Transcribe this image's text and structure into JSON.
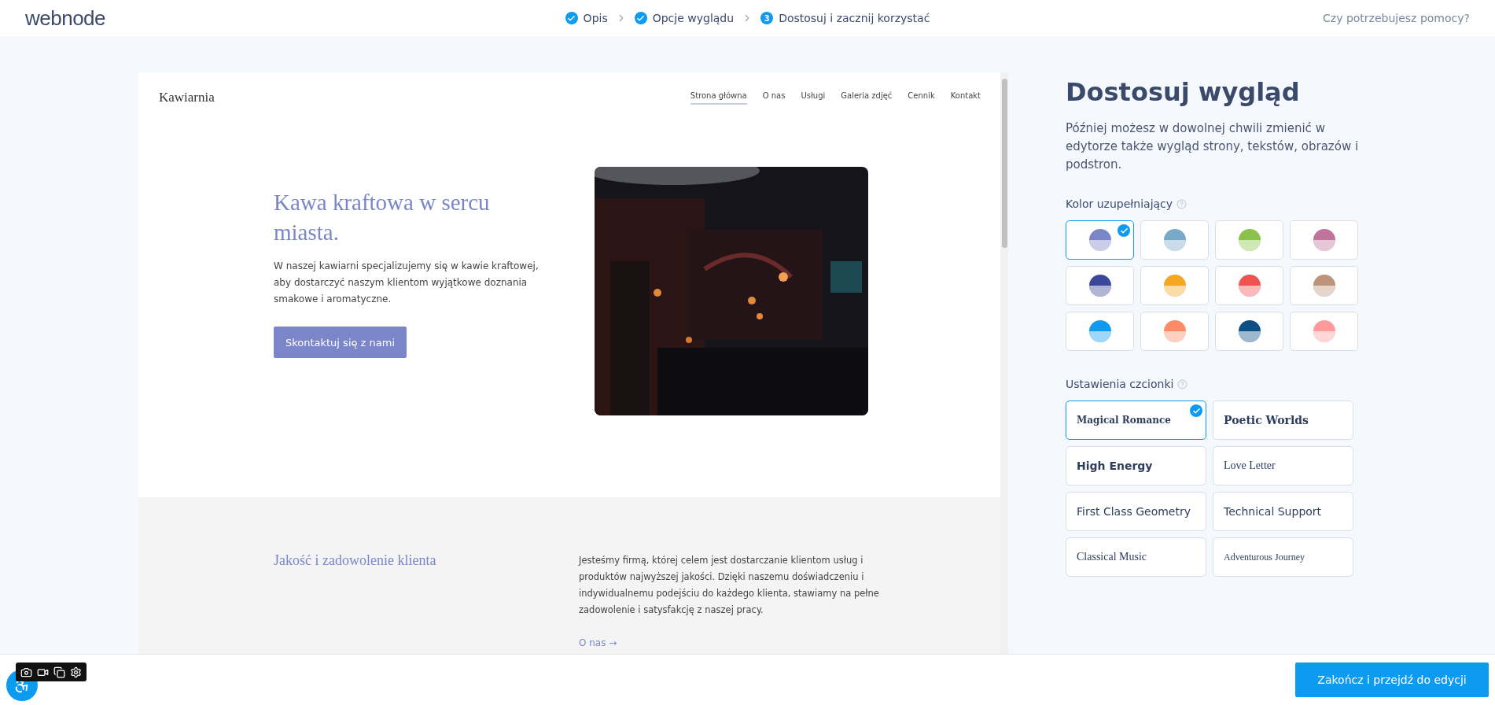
{
  "header": {
    "logo": "webnode",
    "steps": [
      {
        "label": "Opis",
        "done": true
      },
      {
        "label": "Opcje wyglądu",
        "done": true
      },
      {
        "number": "3",
        "label": "Dostosuj i zacznij korzystać",
        "done": false
      }
    ],
    "help_link": "Czy potrzebujesz pomocy?"
  },
  "preview": {
    "site_name": "Kawiarnia",
    "nav": [
      {
        "label": "Strona główna",
        "selected": true
      },
      {
        "label": "O nas",
        "selected": false
      },
      {
        "label": "Usługi",
        "selected": false
      },
      {
        "label": "Galeria zdjęć",
        "selected": false
      },
      {
        "label": "Cennik",
        "selected": false
      },
      {
        "label": "Kontakt",
        "selected": false
      }
    ],
    "hero": {
      "heading": "Kawa kraftowa w sercu miasta.",
      "text": "W naszej kawiarni specjalizujemy się w kawie kraftowej, aby dostarczyć naszym klientom wyjątkowe doznania smakowe i aromatyczne.",
      "button": "Skontaktuj się z nami"
    },
    "section": {
      "heading": "Jakość i zadowolenie klienta",
      "text": "Jesteśmy firmą, której celem jest dostarczanie klientom usług i produktów najwyższej jakości. Dzięki naszemu doświadczeniu i indywidualnemu podejściu do każdego klienta, stawiamy na pełne zadowolenie i satysfakcję z naszej pracy.",
      "link": "O nas →"
    }
  },
  "panel": {
    "title": "Dostosuj wygląd",
    "description": "Później możesz w dowolnej chwili zmienić w edytorze także wygląd strony, tekstów, obrazów i podstron.",
    "color_label": "Kolor uzupełniający",
    "colors": [
      {
        "color": "#7b86c8",
        "selected": true
      },
      {
        "color": "#7aa8c8",
        "selected": false
      },
      {
        "color": "#8bc34a",
        "selected": false
      },
      {
        "color": "#c0739b",
        "selected": false
      },
      {
        "color": "#3a479a",
        "selected": false
      },
      {
        "color": "#f5a623",
        "selected": false
      },
      {
        "color": "#ef5350",
        "selected": false
      },
      {
        "color": "#bb9479",
        "selected": false
      },
      {
        "color": "#0d9bf2",
        "selected": false
      },
      {
        "color": "#ff8a65",
        "selected": false
      },
      {
        "color": "#0d4f84",
        "selected": false
      },
      {
        "color": "#ff9a9a",
        "selected": false
      }
    ],
    "font_label": "Ustawienia czcionki",
    "fonts": [
      {
        "label": "Magical Romance",
        "kind": "serif-bold",
        "selected": true
      },
      {
        "label": "Poetic Worlds",
        "kind": "serif-bold",
        "selected": false
      },
      {
        "label": "High Energy",
        "kind": "sans-bold",
        "selected": false
      },
      {
        "label": "Love Letter",
        "kind": "serif",
        "selected": false
      },
      {
        "label": "First Class Geometry",
        "kind": "sans",
        "selected": false
      },
      {
        "label": "Technical Support",
        "kind": "sans",
        "selected": false
      },
      {
        "label": "Classical Music",
        "kind": "serif",
        "selected": false
      },
      {
        "label": "Adventurous Journey",
        "kind": "serif",
        "selected": false
      }
    ]
  },
  "footer": {
    "button": "Zakończ i przejdź do edycji"
  }
}
